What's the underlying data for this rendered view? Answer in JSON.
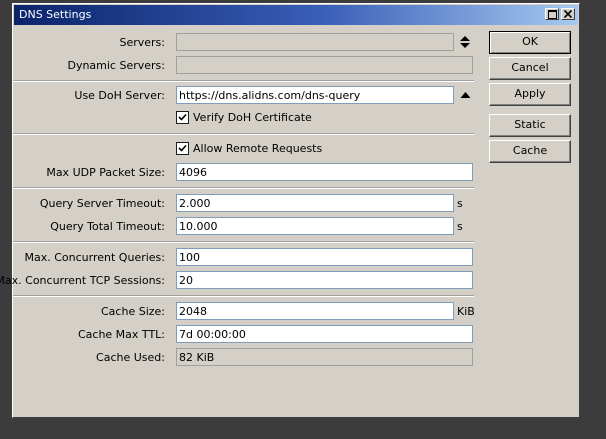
{
  "window": {
    "title": "DNS Settings"
  },
  "form": {
    "servers": {
      "label": "Servers:",
      "value": ""
    },
    "dynamic_servers": {
      "label": "Dynamic Servers:",
      "value": ""
    },
    "use_doh_server": {
      "label": "Use DoH Server:",
      "value": "https://dns.alidns.com/dns-query"
    },
    "verify_doh_certificate": {
      "label": "Verify DoH Certificate",
      "checked": true
    },
    "allow_remote_requests": {
      "label": "Allow Remote Requests",
      "checked": true
    },
    "max_udp_packet_size": {
      "label": "Max UDP Packet Size:",
      "value": "4096"
    },
    "query_server_timeout": {
      "label": "Query Server Timeout:",
      "value": "2.000",
      "unit": "s"
    },
    "query_total_timeout": {
      "label": "Query Total Timeout:",
      "value": "10.000",
      "unit": "s"
    },
    "max_concurrent_queries": {
      "label": "Max. Concurrent Queries:",
      "value": "100"
    },
    "max_concurrent_tcp_sessions": {
      "label": "Max. Concurrent TCP Sessions:",
      "value": "20"
    },
    "cache_size": {
      "label": "Cache Size:",
      "value": "2048",
      "unit": "KiB"
    },
    "cache_max_ttl": {
      "label": "Cache Max TTL:",
      "value": "7d 00:00:00"
    },
    "cache_used": {
      "label": "Cache Used:",
      "value": "82 KiB"
    }
  },
  "buttons": {
    "ok": "OK",
    "cancel": "Cancel",
    "apply": "Apply",
    "static": "Static",
    "cache": "Cache"
  }
}
